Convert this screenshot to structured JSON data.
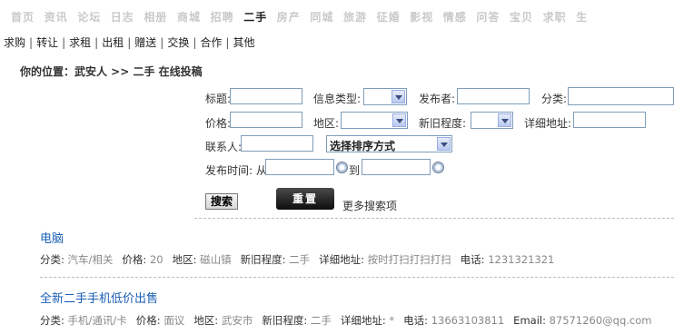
{
  "top_nav": [
    "首页",
    "资讯",
    "论坛",
    "日志",
    "相册",
    "商城",
    "招聘",
    "二手",
    "房产",
    "同城",
    "旅游",
    "征婚",
    "影视",
    "情感",
    "问答",
    "宝贝",
    "求职",
    "生"
  ],
  "top_nav_active": "二手",
  "sub_nav": [
    "求购",
    "转让",
    "求租",
    "出租",
    "赠送",
    "交换",
    "合作",
    "其他"
  ],
  "breadcrumb": "你的位置：武安人 >> 二手 在线投稿",
  "form": {
    "title_label": "标题:",
    "info_type_label": "信息类型:",
    "publisher_label": "发布者:",
    "category_label": "分类:",
    "price_label": "价格:",
    "region_label": "地区:",
    "condition_label": "新旧程度:",
    "address_label": "详细地址:",
    "contact_label": "联系人:",
    "sort_value": "选择排序方式",
    "time_label": "发布时间: 从",
    "to_label": "到",
    "search_button": "搜索",
    "reset_button": "重置",
    "more_search": "更多搜索项"
  },
  "listings": [
    {
      "title": "电脑",
      "meta": [
        {
          "k": "分类:",
          "v": "汽车/相关"
        },
        {
          "k": "价格:",
          "v": "20"
        },
        {
          "k": "地区:",
          "v": "磁山镇"
        },
        {
          "k": "新旧程度:",
          "v": "二手"
        },
        {
          "k": "详细地址:",
          "v": "按时打扫打扫打扫"
        },
        {
          "k": "电话:",
          "v": "1231321321"
        }
      ]
    },
    {
      "title": "全新二手手机低价出售",
      "meta": [
        {
          "k": "分类:",
          "v": "手机/通讯/卡"
        },
        {
          "k": "价格:",
          "v": "面议"
        },
        {
          "k": "地区:",
          "v": "武安市"
        },
        {
          "k": "新旧程度:",
          "v": "二手"
        },
        {
          "k": "详细地址:",
          "v": "*"
        },
        {
          "k": "电话:",
          "v": "13663103811"
        },
        {
          "k": "Email:",
          "v": "87571260@qq.com"
        }
      ]
    }
  ],
  "colors": {
    "link": "#1a5fb4",
    "nav_inactive": "#c9c9c9",
    "meta_value": "#888888"
  }
}
